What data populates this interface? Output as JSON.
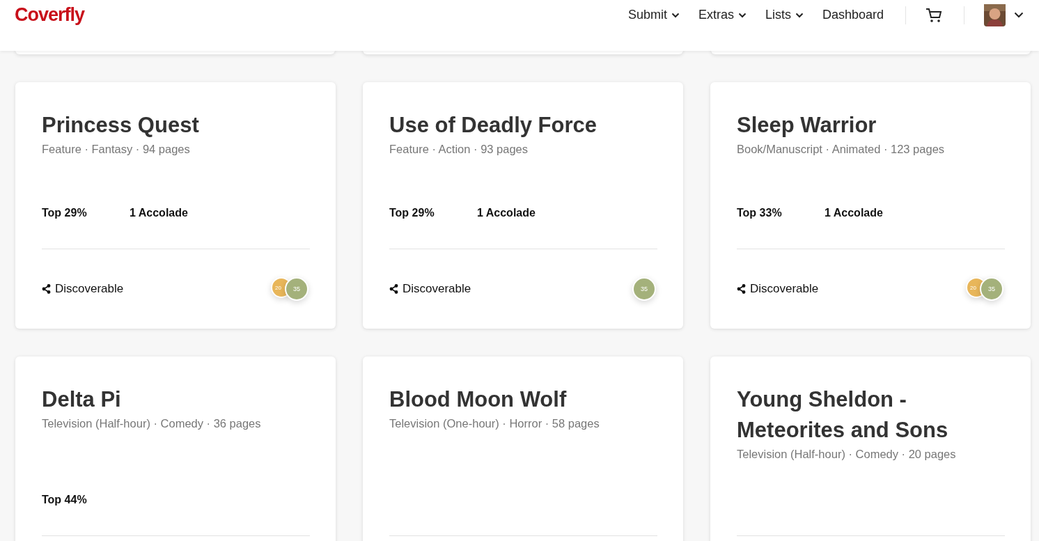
{
  "header": {
    "logo": "Coverfly",
    "nav": [
      {
        "label": "Submit",
        "kind": "dropdown"
      },
      {
        "label": "Extras",
        "kind": "dropdown"
      },
      {
        "label": "Lists",
        "kind": "dropdown"
      },
      {
        "label": "Dashboard",
        "kind": "link"
      }
    ]
  },
  "cards": [
    {
      "title": "Princess Quest",
      "meta": "Feature · Fantasy · 94 pages",
      "rank": "Top 29%",
      "accolades": "1 Accolade",
      "sharing": "Discoverable",
      "badges": [
        {
          "label": "20",
          "color": "#e8b65a"
        },
        {
          "label": "35",
          "color": "#a4b17b"
        }
      ]
    },
    {
      "title": "Use of Deadly Force",
      "meta": "Feature · Action · 93 pages",
      "rank": "Top 29%",
      "accolades": "1 Accolade",
      "sharing": "Discoverable",
      "badges": [
        {
          "label": "35",
          "color": "#a4b17b"
        }
      ]
    },
    {
      "title": "Sleep Warrior",
      "meta": "Book/Manuscript · Animated · 123 pages",
      "rank": "Top 33%",
      "accolades": "1 Accolade",
      "sharing": "Discoverable",
      "badges": [
        {
          "label": "20",
          "color": "#e8b65a"
        },
        {
          "label": "35",
          "color": "#a4b17b"
        }
      ]
    },
    {
      "title": "Delta Pi",
      "meta": "Television (Half-hour) · Comedy · 36 pages",
      "rank": "Top 44%"
    },
    {
      "title": "Blood Moon Wolf",
      "meta": "Television (One-hour) · Horror · 58 pages"
    },
    {
      "title": "Young Sheldon - Meteorites and Sons",
      "meta": "Television (Half-hour) · Comedy · 20 pages"
    }
  ]
}
